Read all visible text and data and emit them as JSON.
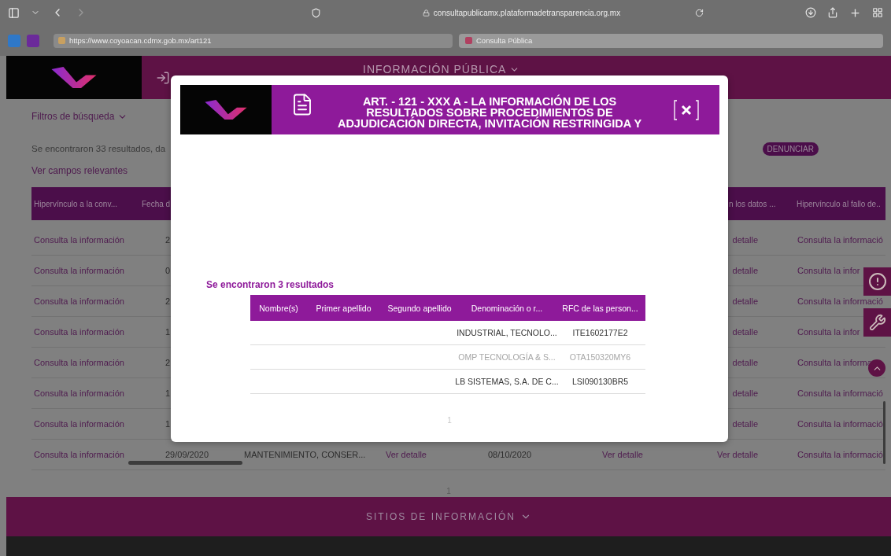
{
  "browser": {
    "address": "consultapublicamx.plataformadetransparencia.org.mx",
    "bookmark_url": "https://www.coyoacan.cdmx.gob.mx/art121",
    "tab": "Consulta Pública"
  },
  "site_header": {
    "nav_label": "INFORMACIÓN PÚBLICA"
  },
  "filters_label": "Filtros de búsqueda",
  "results_summary": "Se encontraron 33 resultados, da",
  "relevant_fields_link": "Ver campos relevantes",
  "report_button": "DENUNCIAR",
  "table": {
    "columns": [
      {
        "label": "Hipervínculo a la conv...",
        "kind": "link"
      },
      {
        "label": "Fecha d",
        "kind": "text"
      },
      {
        "kind": "text"
      },
      {
        "kind": "link"
      },
      {
        "kind": "text"
      },
      {
        "kind": "link"
      },
      {
        "label": "n los datos ...",
        "kind": "link"
      },
      {
        "label": "Hipervínculo al fallo de..",
        "kind": "link"
      }
    ],
    "rows": [
      {
        "cells": [
          "Consulta la información",
          "2",
          null,
          null,
          null,
          null,
          "detalle",
          "Consulta la informació"
        ]
      },
      {
        "cells": [
          "Consulta la información",
          "0",
          null,
          null,
          null,
          null,
          "detalle",
          "Consulta la infor"
        ]
      },
      {
        "cells": [
          "Consulta la información",
          "2",
          null,
          null,
          null,
          null,
          "detalle",
          "Consulta la informació"
        ]
      },
      {
        "cells": [
          "Consulta la información",
          "1",
          null,
          null,
          null,
          null,
          "detalle",
          "Consulta la infor"
        ]
      },
      {
        "cells": [
          "Consulta la información",
          "2",
          null,
          null,
          null,
          null,
          "detalle",
          "Consulta la informa"
        ]
      },
      {
        "cells": [
          "Consulta la información",
          "1",
          null,
          null,
          null,
          null,
          "detalle",
          "Consulta la informació"
        ]
      },
      {
        "cells": [
          "Consulta la información",
          "1",
          null,
          null,
          null,
          null,
          "detalle",
          "Consulta la informació"
        ]
      },
      {
        "cells": [
          "Consulta la información",
          "29/09/2020",
          "MANTENIMIENTO, CONSER...",
          "Ver detalle",
          "08/10/2020",
          "Ver detalle",
          "Ver detalle",
          "Consulta la informació"
        ]
      }
    ]
  },
  "page_number": "1",
  "footer": {
    "label": "SITIOS DE INFORMACIÓN"
  },
  "modal": {
    "title_lines": [
      "ART. - 121 - XXX A - LA INFORMACIÓN DE LOS",
      "RESULTADOS SOBRE PROCEDIMIENTOS DE",
      "ADJUDICACIÓN DIRECTA, INVITACIÓN RESTRINGIDA Y"
    ],
    "results": "Se encontraron 3 resultados",
    "columns": [
      "Nombre(s)",
      "Primer apellido",
      "Segundo apellido",
      "Denominación o r...",
      "RFC de las person..."
    ],
    "rows": [
      {
        "cells": [
          null,
          null,
          null,
          "INDUSTRIAL, TECNOLO...",
          "ITE1602177E2"
        ],
        "muted": false
      },
      {
        "cells": [
          null,
          null,
          null,
          "OMP TECNOLOGÍA & S...",
          "OTA150320MY6"
        ],
        "muted": true
      },
      {
        "cells": [
          null,
          null,
          null,
          "LB SISTEMAS, S.A. DE C...",
          "LSI090130BR5"
        ],
        "muted": false
      }
    ],
    "page_number": "1"
  }
}
